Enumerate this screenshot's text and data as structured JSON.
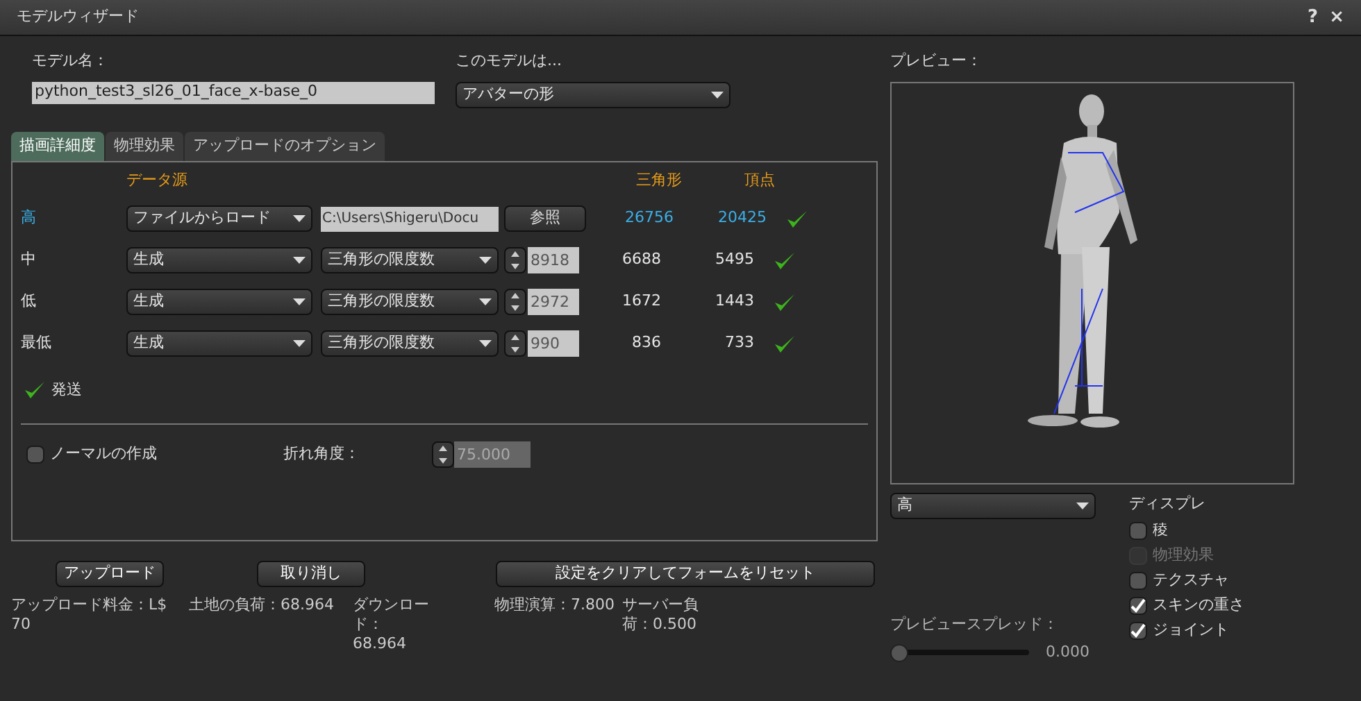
{
  "window": {
    "title": "モデルウィザード",
    "help": "?",
    "close": "×"
  },
  "model_name": {
    "label": "モデル名：",
    "value": "python_test3_sl26_01_face_x-base_0"
  },
  "model_type": {
    "label": "このモデルは...",
    "value": "アバターの形"
  },
  "tabs": [
    {
      "label": "描画詳細度",
      "selected": true
    },
    {
      "label": "物理効果",
      "selected": false
    },
    {
      "label": "アップロードのオプション",
      "selected": false
    }
  ],
  "lod_table": {
    "columns": [
      "データ源",
      "三角形",
      "頂点"
    ],
    "rows": [
      {
        "label": "高",
        "kind": "file",
        "selected": true,
        "source": "ファイルからロード",
        "path": "C:\\Users\\Shigeru\\Docu",
        "browse": "参照",
        "triangles": "26756",
        "vertices": "20425",
        "ok": true
      },
      {
        "label": "中",
        "kind": "generate",
        "selected": false,
        "source": "生成",
        "method": "三角形の限度数",
        "limit": "8918",
        "triangles": "6688",
        "vertices": "5495",
        "ok": true
      },
      {
        "label": "低",
        "kind": "generate",
        "selected": false,
        "source": "生成",
        "method": "三角形の限度数",
        "limit": "2972",
        "triangles": "1672",
        "vertices": "1443",
        "ok": true
      },
      {
        "label": "最低",
        "kind": "generate",
        "selected": false,
        "source": "生成",
        "method": "三角形の限度数",
        "limit": "990",
        "triangles": "836",
        "vertices": "733",
        "ok": true
      }
    ]
  },
  "upload_status": {
    "label": "発送",
    "ok": true
  },
  "generate_normals": {
    "label": "ノーマルの作成",
    "checked": false
  },
  "crease_angle": {
    "label": "折れ角度：",
    "value": "75.000",
    "disabled": true
  },
  "buttons": [
    "アップロード",
    "取り消し",
    "設定をクリアしてフォームをリセット"
  ],
  "costs": [
    "アップロード料金：L$ 70",
    "土地の負荷：68.964",
    "ダウンロード：68.964",
    "物理演算：7.800",
    "サーバー負荷：0.500"
  ],
  "preview": {
    "label": "プレビュー：",
    "kind": "picture",
    "lod": "高"
  },
  "display": {
    "label": "ディスプレ",
    "options": [
      {
        "label": "稜",
        "checked": false,
        "disabled": false
      },
      {
        "label": "物理効果",
        "checked": false,
        "disabled": true
      },
      {
        "label": "テクスチャ",
        "checked": false,
        "disabled": false
      },
      {
        "label": "スキンの重さ",
        "checked": true,
        "disabled": false
      },
      {
        "label": "ジョイント",
        "checked": true,
        "disabled": false
      }
    ]
  },
  "preview_spread": {
    "label": "プレビュースプレッド：",
    "level": 0,
    "reading": "0.000"
  }
}
